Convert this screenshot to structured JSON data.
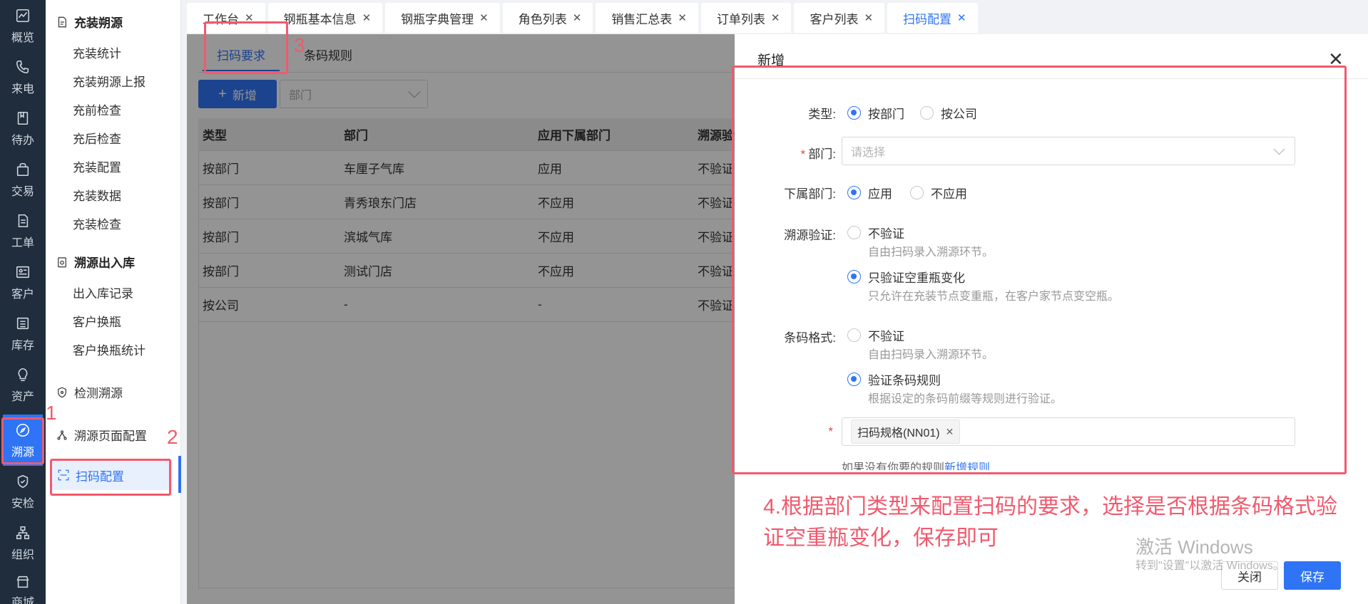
{
  "rail": [
    {
      "label": "概览",
      "icon": "chart-icon"
    },
    {
      "label": "来电",
      "icon": "phone-icon"
    },
    {
      "label": "待办",
      "icon": "bookmark-icon"
    },
    {
      "label": "交易",
      "icon": "bag-icon"
    },
    {
      "label": "工单",
      "icon": "document-icon"
    },
    {
      "label": "客户",
      "icon": "id-card-icon"
    },
    {
      "label": "库存",
      "icon": "list-icon"
    },
    {
      "label": "资产",
      "icon": "bulb-icon"
    },
    {
      "label": "溯源",
      "icon": "compass-icon"
    },
    {
      "label": "安检",
      "icon": "shield-icon"
    },
    {
      "label": "组织",
      "icon": "org-icon"
    },
    {
      "label": "商城",
      "icon": "store-icon"
    }
  ],
  "submenu": {
    "group1": {
      "title": "充装朔源",
      "items": [
        "充装统计",
        "充装朔源上报",
        "充前检查",
        "充后检查",
        "充装配置",
        "充装数据",
        "充装检查"
      ]
    },
    "group2": {
      "title": "溯源出入库",
      "items": [
        "出入库记录",
        "客户换瓶",
        "客户换瓶统计"
      ]
    },
    "detect": "检测溯源",
    "page_config": "溯源页面配置",
    "scan_config": "扫码配置"
  },
  "tabs": [
    {
      "label": "工作台"
    },
    {
      "label": "钢瓶基本信息"
    },
    {
      "label": "钢瓶字典管理"
    },
    {
      "label": "角色列表"
    },
    {
      "label": "销售汇总表"
    },
    {
      "label": "订单列表"
    },
    {
      "label": "客户列表"
    },
    {
      "label": "扫码配置"
    }
  ],
  "content": {
    "tabs": [
      "扫码要求",
      "条码规则"
    ],
    "add_button": "新增",
    "dept_placeholder": "部门",
    "columns": [
      "类型",
      "部门",
      "应用下属部门",
      "溯源验证"
    ],
    "rows": [
      [
        "按部门",
        "车厘子气库",
        "应用",
        "不验证"
      ],
      [
        "按部门",
        "青秀琅东门店",
        "不应用",
        "不验证"
      ],
      [
        "按部门",
        "滨城气库",
        "不应用",
        "不验证"
      ],
      [
        "按部门",
        "测试门店",
        "不应用",
        "不验证"
      ],
      [
        "按公司",
        "-",
        "-",
        "不验证"
      ]
    ]
  },
  "drawer": {
    "title": "新增",
    "type_label": "类型:",
    "type_opt1": "按部门",
    "type_opt2": "按公司",
    "dept_label": "部门:",
    "dept_placeholder": "请选择",
    "sub_label": "下属部门:",
    "sub_opt1": "应用",
    "sub_opt2": "不应用",
    "trace_label": "溯源验证:",
    "trace_opt1": "不验证",
    "trace_opt1_hint": "自由扫码录入溯源环节。",
    "trace_opt2": "只验证空重瓶变化",
    "trace_opt2_hint": "只允许在充装节点变重瓶，在客户家节点变空瓶。",
    "barcode_label": "条码格式:",
    "barcode_opt1": "不验证",
    "barcode_opt1_hint": "自由扫码录入溯源环节。",
    "barcode_opt2": "验证条码规则",
    "barcode_opt2_hint": "根据设定的条码前缀等规则进行验证。",
    "rule_tag": "扫码规格(NN01)",
    "more_text": "如果没有你要的规则",
    "more_link": "新增规则",
    "close_button": "关闭",
    "save_button": "保存"
  },
  "annotations": {
    "n1": "1",
    "n2": "2",
    "n3": "3",
    "text": "4.根据部门类型来配置扫码的要求，选择是否根据条码格式验证空重瓶变化，保存即可"
  },
  "watermark": {
    "line1": "激活 Windows",
    "line2": "转到\"设置\"以激活 Windows。"
  },
  "colors": {
    "primary": "#2f74f5",
    "annotation": "#f05a6e",
    "rail": "#1f2d3d"
  }
}
